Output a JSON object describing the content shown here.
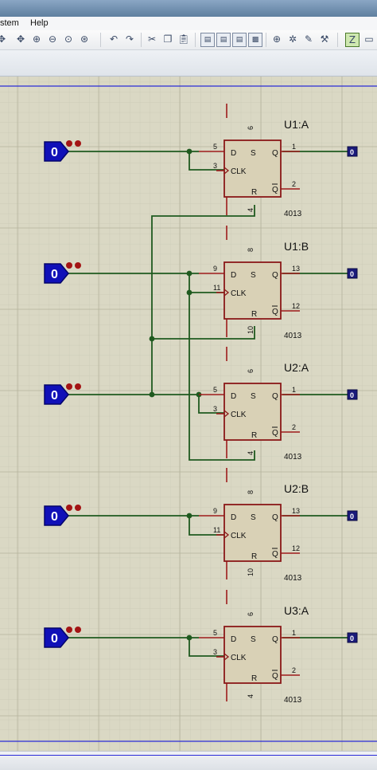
{
  "menu": {
    "system": "stem",
    "help": "Help"
  },
  "toolbar_icons": [
    "move-icon",
    "zoom-in-icon",
    "zoom-out-icon",
    "zoom-all-icon",
    "zoom-area-icon",
    "undo-icon",
    "redo-icon",
    "cut-icon",
    "copy-icon",
    "paste-icon",
    "block-copy-icon",
    "block-move-icon",
    "block-rotate-icon",
    "block-delete-icon",
    "pick-device-icon",
    "make-device-icon",
    "package-tool-icon",
    "decompose-icon",
    "annotate-icon"
  ],
  "schematic": {
    "part_code": "4013",
    "pin_labels": {
      "d": "D",
      "s": "S",
      "clk": "CLK",
      "q": "Q",
      "r": "R",
      "qbar": "Q"
    },
    "logic_inputs": [
      "0",
      "0",
      "0",
      "0",
      "0"
    ],
    "logic_probes": [
      "0",
      "0",
      "0",
      "0",
      "0"
    ],
    "flipflops": [
      {
        "name": "U1:A",
        "pin_d": "5",
        "pin_clk": "3",
        "pin_s": "6",
        "pin_r": "4",
        "pin_q": "1",
        "pin_qbar": "2"
      },
      {
        "name": "U1:B",
        "pin_d": "9",
        "pin_clk": "11",
        "pin_s": "8",
        "pin_r": "10",
        "pin_q": "13",
        "pin_qbar": "12"
      },
      {
        "name": "U2:A",
        "pin_d": "5",
        "pin_clk": "3",
        "pin_s": "6",
        "pin_r": "4",
        "pin_q": "1",
        "pin_qbar": "2"
      },
      {
        "name": "U2:B",
        "pin_d": "9",
        "pin_clk": "11",
        "pin_s": "8",
        "pin_r": "10",
        "pin_q": "13",
        "pin_qbar": "12"
      },
      {
        "name": "U3:A",
        "pin_d": "5",
        "pin_clk": "3",
        "pin_s": "6",
        "pin_r": "4",
        "pin_q": "1",
        "pin_qbar": "2"
      }
    ]
  }
}
